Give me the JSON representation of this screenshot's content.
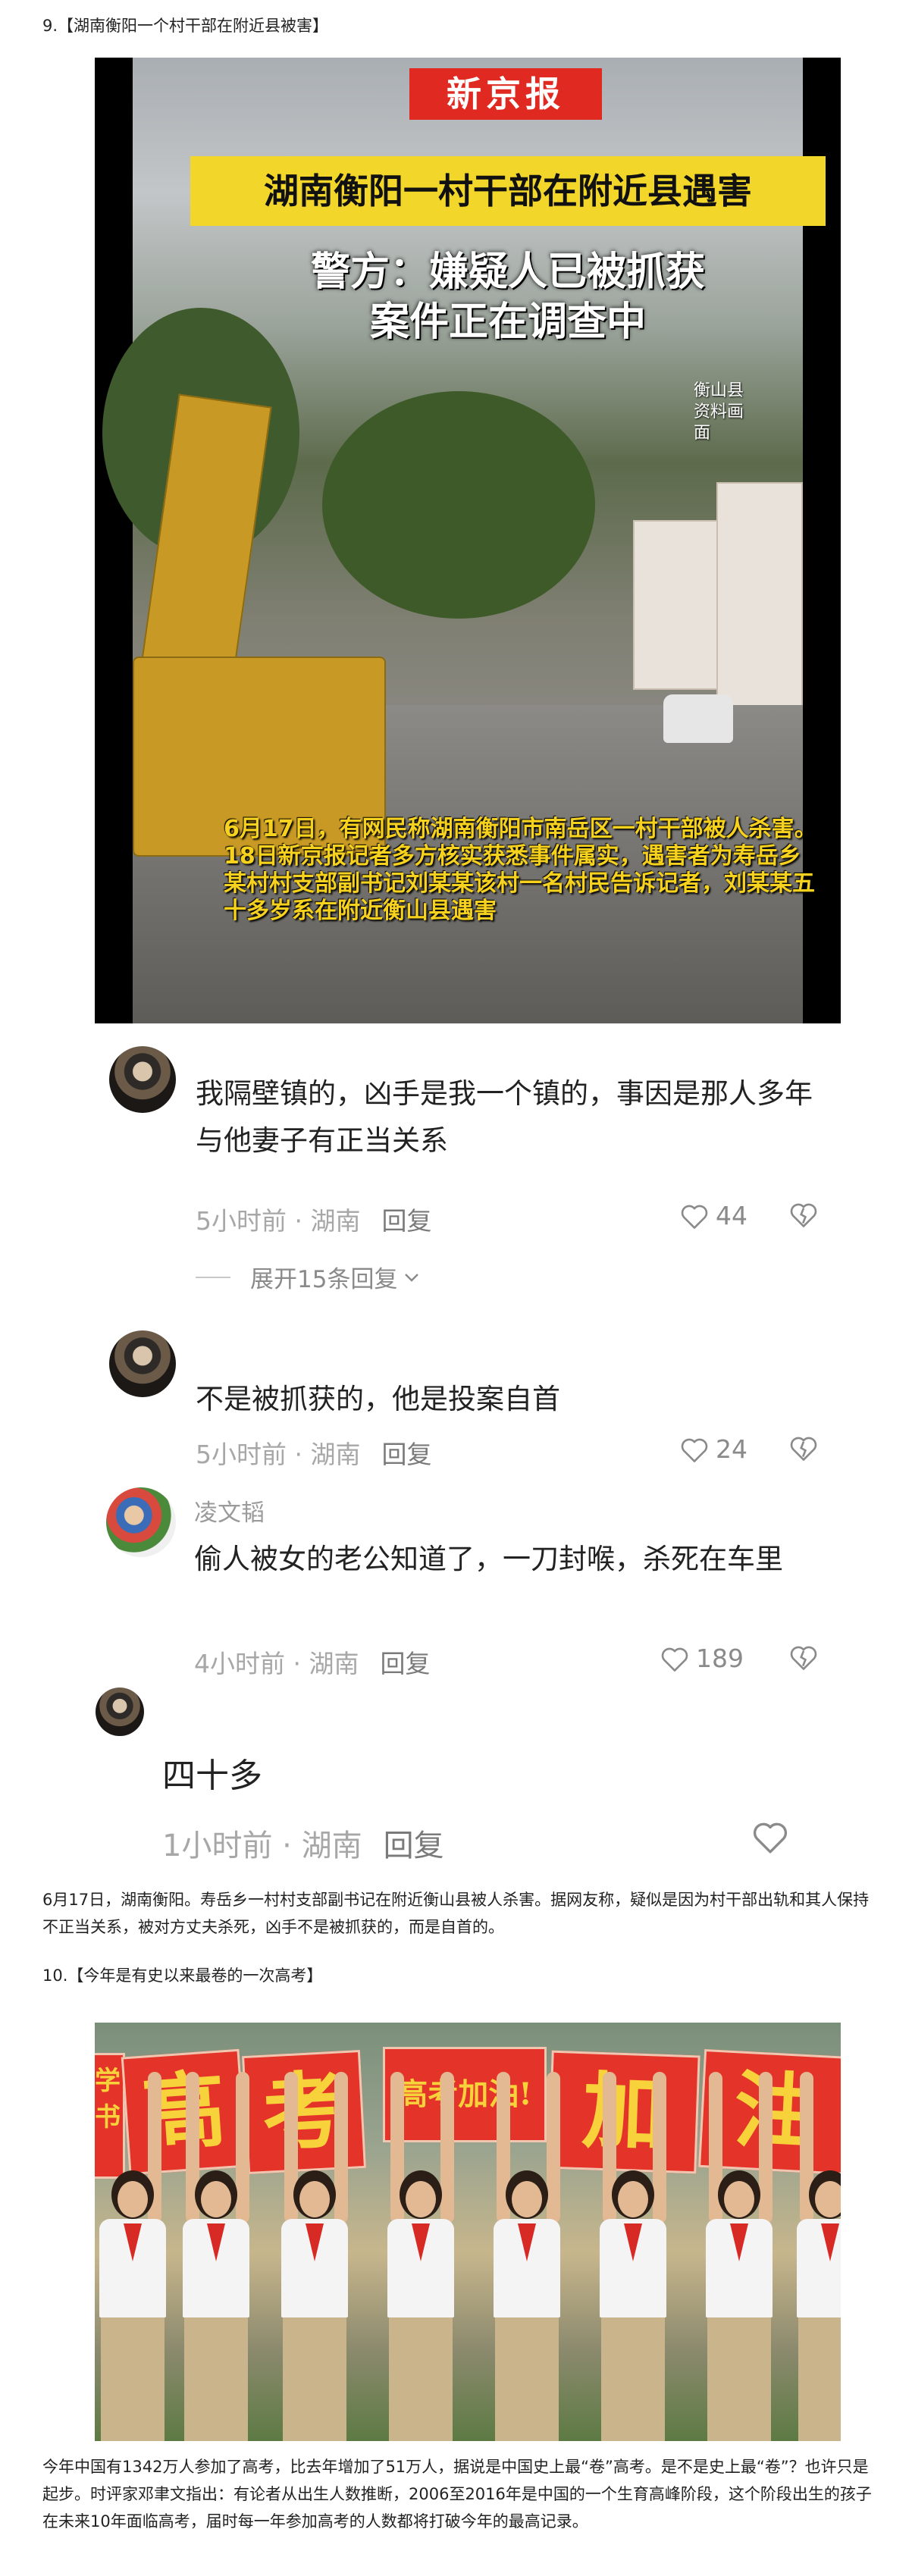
{
  "section9": {
    "heading": "9.【湖南衡阳一个村干部在附近县被害】",
    "video": {
      "logo": "新京报",
      "headline": "湖南衡阳一村干部在附近县遇害",
      "subtitle_line1": "警方：嫌疑人已被抓获",
      "subtitle_line2": "案件正在调查中",
      "watermark_line1": "衡山县",
      "watermark_line2": "资料画面",
      "caption": "6月17日，有网民称湖南衡阳市南岳区一村干部被人杀害。18日新京报记者多方核实获悉事件属实，遇害者为寿岳乡某村村支部副书记刘某某该村一名村民告诉记者，刘某某五十多岁系在附近衡山县遇害"
    },
    "comments": [
      {
        "text": "我隔壁镇的，凶手是我一个镇的，事因是那人多年与他妻子有正当关系",
        "time_location": "5小时前 · 湖南",
        "reply": "回复",
        "likes": "44",
        "expand": "展开15条回复"
      },
      {
        "text": "不是被抓获的，他是投案自首",
        "time_location": "5小时前 · 湖南",
        "reply": "回复",
        "likes": "24"
      },
      {
        "username": "凌文韬",
        "text": "偷人被女的老公知道了，一刀封喉，杀死在车里",
        "time_location": "4小时前 · 湖南",
        "reply": "回复",
        "likes": "189"
      },
      {
        "text": "四十多",
        "time_location": "1小时前 · 湖南",
        "reply": "回复"
      }
    ],
    "paragraph": "6月17日，湖南衡阳。寿岳乡一村村支部副书记在附近衡山县被人杀害。据网友称，疑似是因为村干部出轨和其人保持不正当关系，被对方丈夫杀死，凶手不是被抓获的，而是自首的。"
  },
  "section10": {
    "heading": "10.【今年是有史以来最卷的一次高考】",
    "photo": {
      "sign1": "高",
      "sign2": "考",
      "sign3": "高考加油!",
      "sign4": "加",
      "sign5": "油",
      "left_edge_text": "学书"
    },
    "paragraph": "今年中国有1342万人参加了高考，比去年增加了51万人，据说是中国史上最“卷”高考。是不是史上最“卷”？也许只是起步。时评家邓聿文指出：有论者从出生人数推断，2006至2016年是中国的一个生育高峰阶段，这个阶段出生的孩子在未来10年面临高考，届时每一年参加高考的人数都将打破今年的最高记录。"
  },
  "colors": {
    "logo_red": "#e02a21",
    "headline_yellow": "#f2d72a",
    "caption_yellow": "#f6d21e",
    "meta_gray": "#a7a7a7",
    "sign_red": "#e4342a"
  },
  "icons": [
    "heart-outline-icon",
    "broken-heart-icon",
    "chevron-down-icon"
  ]
}
